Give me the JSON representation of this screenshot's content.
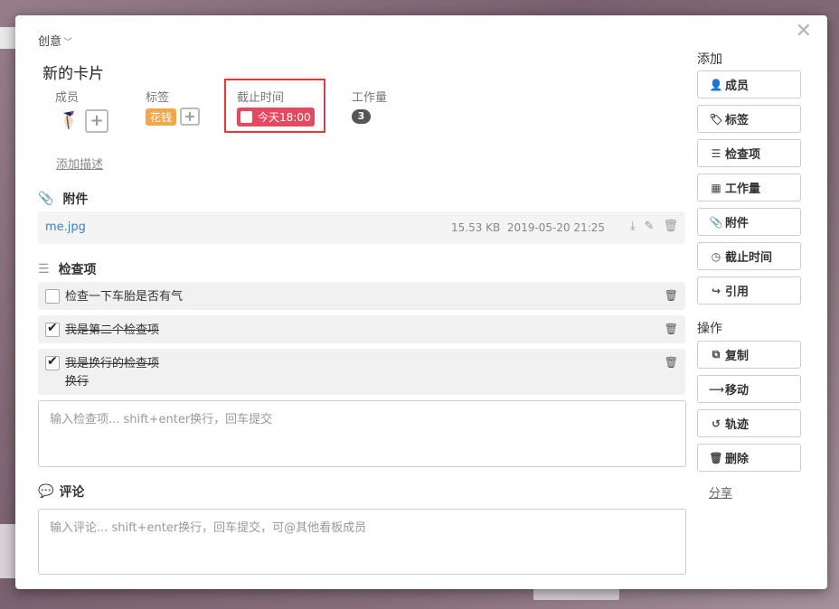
{
  "card": {
    "list_name": "创意",
    "title": "新的卡片",
    "close_icon": "close-icon"
  },
  "fields": {
    "members_label": "成员",
    "labels_label": "标签",
    "label_chip": "花钱",
    "due_label": "截止时间",
    "due_value": "今天18:00",
    "work_label": "工作量",
    "work_value": "3",
    "add_description": "添加描述"
  },
  "attachments": {
    "heading": "附件",
    "items": [
      {
        "name": "me.jpg",
        "size": "15.53 KB",
        "date": "2019-05-20 21:25"
      }
    ]
  },
  "checklist": {
    "heading": "检查项",
    "items": [
      {
        "text": "检查一下车胎是否有气",
        "checked": false
      },
      {
        "text": "我是第二个检查项",
        "checked": true
      },
      {
        "text": "我是换行的检查项",
        "text2": "换行",
        "checked": true
      }
    ],
    "placeholder": "输入检查项... shift+enter换行，回车提交"
  },
  "comments": {
    "heading": "评论",
    "placeholder": "输入评论... shift+enter换行，回车提交，可@其他看板成员"
  },
  "sidebar": {
    "add_title": "添加",
    "add_buttons": [
      "成员",
      "标签",
      "检查项",
      "工作量",
      "附件",
      "截止时间",
      "引用"
    ],
    "ops_title": "操作",
    "ops_buttons": [
      "复制",
      "移动",
      "轨迹",
      "删除"
    ],
    "share": "分享"
  },
  "colors": {
    "label_chip": "#f0a84b",
    "due_chip": "#e54960",
    "due_highlight": "#e03a3a",
    "link": "#3b82c4"
  }
}
